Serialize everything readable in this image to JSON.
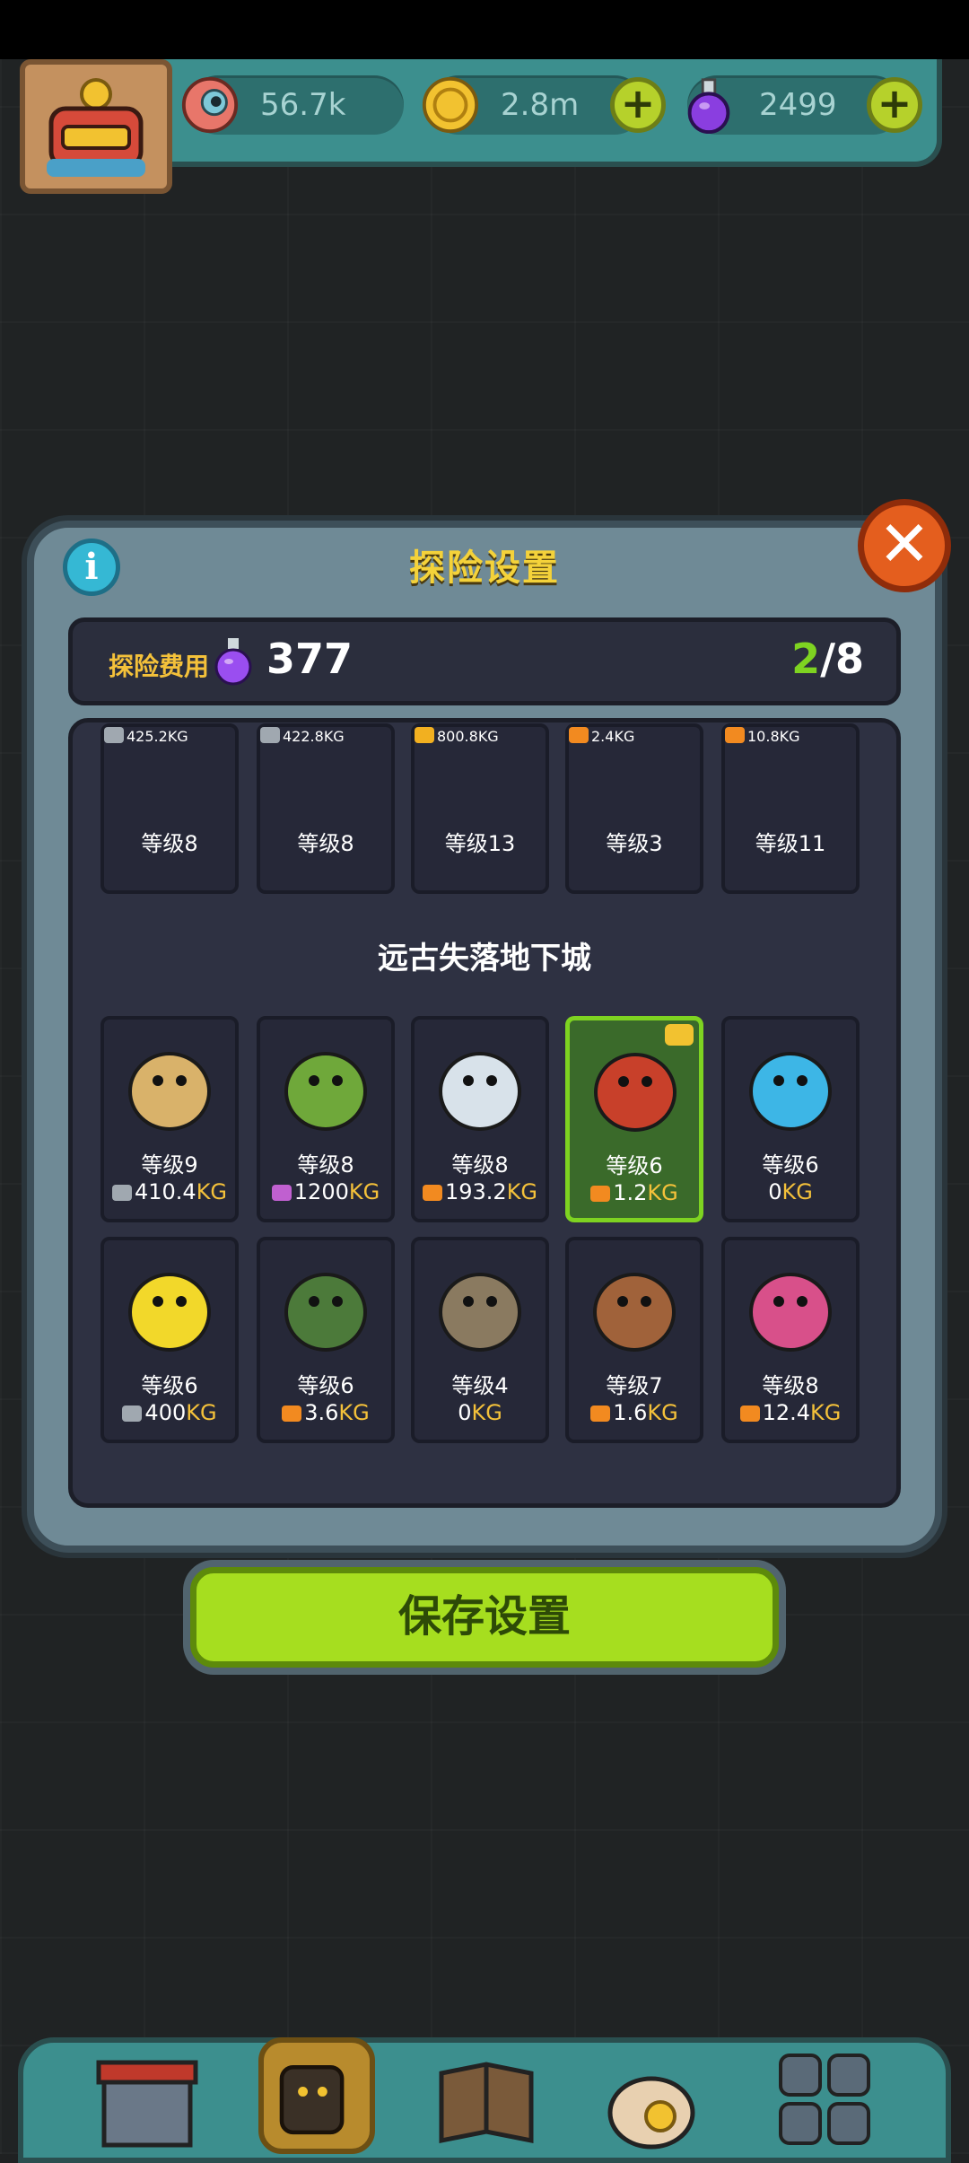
{
  "resources": [
    {
      "id": "eyeball",
      "icon": "eyeball-icon",
      "value": "56.7k"
    },
    {
      "id": "coin",
      "icon": "coin-icon",
      "value": "2.8m"
    },
    {
      "id": "potion",
      "icon": "potion-icon",
      "value": "2499"
    }
  ],
  "dialog": {
    "title": "探险设置",
    "cost_label": "探险费用",
    "cost_value": "377",
    "count_current": "2",
    "count_total": "/8",
    "section_title": "远古失落地下城",
    "save_label": "保存设置"
  },
  "partial_row": [
    {
      "level": "等级8",
      "weight_num": "425.2",
      "unit": "KG",
      "bag": "#a0a8b0"
    },
    {
      "level": "等级8",
      "weight_num": "422.8",
      "unit": "KG",
      "bag": "#a0a8b0"
    },
    {
      "level": "等级13",
      "weight_num": "800.8",
      "unit": "KG",
      "bag": "#f2b020"
    },
    {
      "level": "等级3",
      "weight_num": "2.4",
      "unit": "KG",
      "bag": "#f28a20"
    },
    {
      "level": "等级11",
      "weight_num": "10.8",
      "unit": "KG",
      "bag": "#f28a20"
    }
  ],
  "monsters": [
    {
      "name": "card-scarecrow-king",
      "level": "等级9",
      "weight_num": "410.4",
      "unit": "KG",
      "bag": "#a0a8b0",
      "color": "#d9b26a",
      "selected": false
    },
    {
      "name": "card-mandrake",
      "level": "等级8",
      "weight_num": "1200",
      "unit": "KG",
      "bag": "#c060d0",
      "color": "#6fa83a",
      "selected": false
    },
    {
      "name": "card-yeti",
      "level": "等级8",
      "weight_num": "193.2",
      "unit": "KG",
      "bag": "#f28a20",
      "color": "#d8e2ea",
      "selected": false
    },
    {
      "name": "card-red-dino",
      "level": "等级6",
      "weight_num": "1.2",
      "unit": "KG",
      "bag": "#f28a20",
      "color": "#c8402a",
      "selected": true
    },
    {
      "name": "card-blue-blob",
      "level": "等级6",
      "weight_num": "0",
      "unit": "KG",
      "bag": "",
      "color": "#3db6e6",
      "selected": false
    },
    {
      "name": "card-yellow-lizard",
      "level": "等级6",
      "weight_num": "400",
      "unit": "KG",
      "bag": "#a0a8b0",
      "color": "#f2d82a",
      "selected": false
    },
    {
      "name": "card-top-hat-goblin",
      "level": "等级6",
      "weight_num": "3.6",
      "unit": "KG",
      "bag": "#f28a20",
      "color": "#4c7a3a",
      "selected": false
    },
    {
      "name": "card-treasure-chest",
      "level": "等级4",
      "weight_num": "0",
      "unit": "KG",
      "bag": "",
      "color": "#8a7a60",
      "selected": false
    },
    {
      "name": "card-brown-bear",
      "level": "等级7",
      "weight_num": "1.6",
      "unit": "KG",
      "bag": "#f28a20",
      "color": "#a0623a",
      "selected": false
    },
    {
      "name": "card-pink-chameleon",
      "level": "等级8",
      "weight_num": "12.4",
      "unit": "KG",
      "bag": "#f28a20",
      "color": "#d8508a",
      "selected": false
    }
  ],
  "colors": {
    "accent": "#a6de1f",
    "title": "#f4d23a",
    "count_current": "#7ed321",
    "unit": "#f4c13a"
  }
}
